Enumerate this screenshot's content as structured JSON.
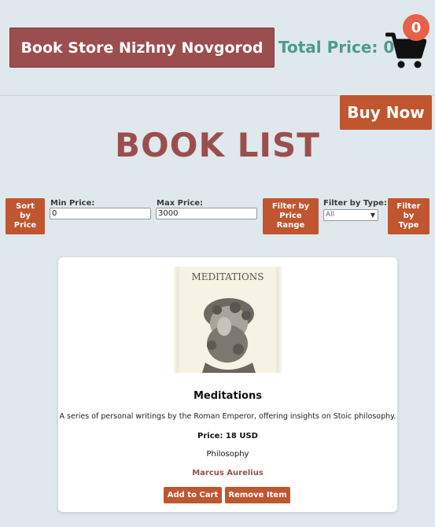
{
  "header": {
    "store_name": "Book Store Nizhny Novgorod",
    "total_label": "Total Price: 0",
    "cart_count": "0",
    "buy_now": "Buy Now"
  },
  "page_title": "BOOK LIST",
  "filters": {
    "sort_label": "Sort\nby\nPrice",
    "min_label": "Min Price:",
    "min_value": "0",
    "max_label": "Max Price:",
    "max_value": "3000",
    "range_button": "Filter by\nPrice\nRange",
    "type_label": "Filter by Type:",
    "type_selected": "All",
    "type_button": "Filter\nby\nType"
  },
  "book": {
    "cover_title": "MEDITATIONS",
    "title": "Meditations",
    "description": "A series of personal writings by the Roman Emperor, offering insights on Stoic philosophy.",
    "price": "Price: 18 USD",
    "genre": "Philosophy",
    "author": "Marcus Aurelius",
    "add_button": "Add to Cart",
    "remove_button": "Remove Item"
  },
  "colors": {
    "background": "#dfe8ec",
    "brand": "#9b4e4e",
    "accent": "#c0562f",
    "total": "#4e9a8c",
    "badge": "#e8604a"
  },
  "icons": [
    "cart-icon"
  ]
}
